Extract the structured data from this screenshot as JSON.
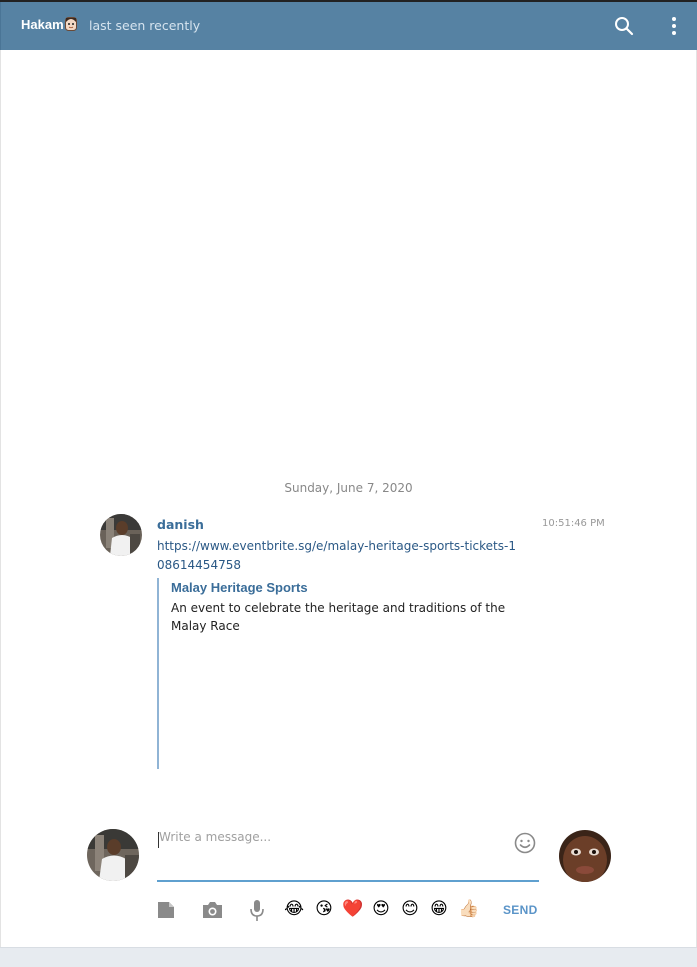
{
  "header": {
    "contact_name": "Hakam",
    "status": "last seen recently"
  },
  "chat": {
    "date_separator": "Sunday, June 7, 2020",
    "message": {
      "sender": "danish",
      "time": "10:51:46 PM",
      "link_text": "https://www.eventbrite.sg/e/malay-heritage-sports-tickets-108614454758",
      "preview": {
        "title": "Malay Heritage Sports",
        "description": "An event to celebrate the heritage and traditions of the Malay Race"
      }
    }
  },
  "composer": {
    "placeholder": "Write a message...",
    "send_label": "SEND",
    "emojis": [
      "😂",
      "😘",
      "❤️",
      "😍",
      "😊",
      "😁",
      "👍🏻"
    ]
  },
  "colors": {
    "header_bg": "#5682a3",
    "accent": "#5fa0cf",
    "link": "#2a5885"
  }
}
